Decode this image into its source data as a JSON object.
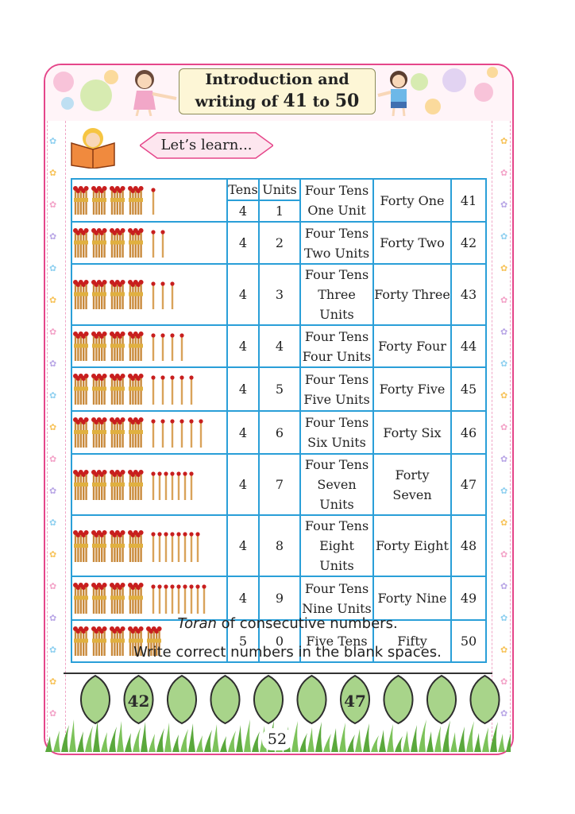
{
  "title": {
    "line1": "Introduction and",
    "line2_prefix": "writing of ",
    "line2_num1": "41",
    "line2_mid": " to ",
    "line2_num2": "50"
  },
  "learn_banner": "Let’s learn...",
  "table": {
    "header_tens": "Tens",
    "header_units": "Units",
    "rows": [
      {
        "tens": "4",
        "units": "1",
        "words_line1": "Four Tens",
        "words_line2": "One Unit",
        "name": "Forty One",
        "number": "41"
      },
      {
        "tens": "4",
        "units": "2",
        "words_line1": "Four Tens",
        "words_line2": "Two Units",
        "name": "Forty Two",
        "number": "42"
      },
      {
        "tens": "4",
        "units": "3",
        "words_line1": "Four Tens",
        "words_line2": "Three Units",
        "name": "Forty Three",
        "number": "43"
      },
      {
        "tens": "4",
        "units": "4",
        "words_line1": "Four Tens",
        "words_line2": "Four Units",
        "name": "Forty Four",
        "number": "44"
      },
      {
        "tens": "4",
        "units": "5",
        "words_line1": "Four Tens",
        "words_line2": "Five Units",
        "name": "Forty Five",
        "number": "45"
      },
      {
        "tens": "4",
        "units": "6",
        "words_line1": "Four Tens",
        "words_line2": "Six Units",
        "name": "Forty Six",
        "number": "46"
      },
      {
        "tens": "4",
        "units": "7",
        "words_line1": "Four Tens",
        "words_line2": "Seven Units",
        "name": "Forty Seven",
        "number": "47"
      },
      {
        "tens": "4",
        "units": "8",
        "words_line1": "Four Tens",
        "words_line2": "Eight Units",
        "name": "Forty Eight",
        "number": "48"
      },
      {
        "tens": "4",
        "units": "9",
        "words_line1": "Four Tens",
        "words_line2": "Nine Units",
        "name": "Forty Nine",
        "number": "49"
      },
      {
        "tens": "5",
        "units": "0",
        "words_line1": "Five Tens",
        "words_line2": "",
        "name": "Fifty",
        "number": "50"
      }
    ]
  },
  "toran": {
    "italic_word": "Toran",
    "rest": " of consecutive numbers.",
    "instruction": "Write correct numbers in the blank spaces."
  },
  "leaves": [
    "",
    "42",
    "",
    "",
    "",
    "",
    "47",
    "",
    "",
    ""
  ],
  "page_number": "52",
  "colors": {
    "border": "#e5468a",
    "table_line": "#2a9fd8",
    "leaf": "#a8d48a"
  }
}
